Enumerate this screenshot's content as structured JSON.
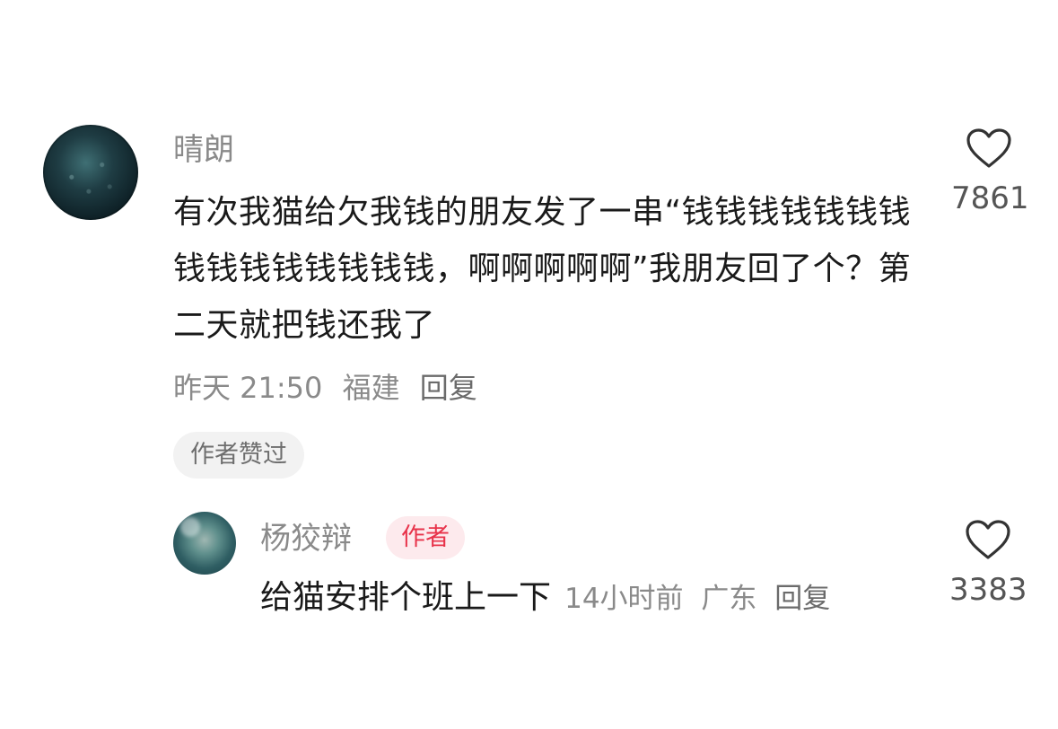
{
  "comment": {
    "username": "晴朗",
    "text": "有次我猫给欠我钱的朋友发了一串“钱钱钱钱钱钱钱钱钱钱钱钱钱钱钱，啊啊啊啊啊”我朋友回了个？第二天就把钱还我了",
    "time": "昨天 21:50",
    "location": "福建",
    "reply_label": "回复",
    "liked_by_author_label": "作者赞过",
    "like_count": "7861"
  },
  "reply": {
    "username": "杨狡辩",
    "author_tag": "作者",
    "text": "给猫安排个班上一下",
    "time": "14小时前",
    "location": "广东",
    "reply_label": "回复",
    "like_count": "3383"
  },
  "icons": {
    "like": "heart-outline-icon"
  },
  "colors": {
    "author_tag_text": "#e8334a",
    "author_tag_bg": "#fdeaed",
    "secondary_text": "#8a8a8a",
    "primary_text": "#1a1a1a"
  }
}
